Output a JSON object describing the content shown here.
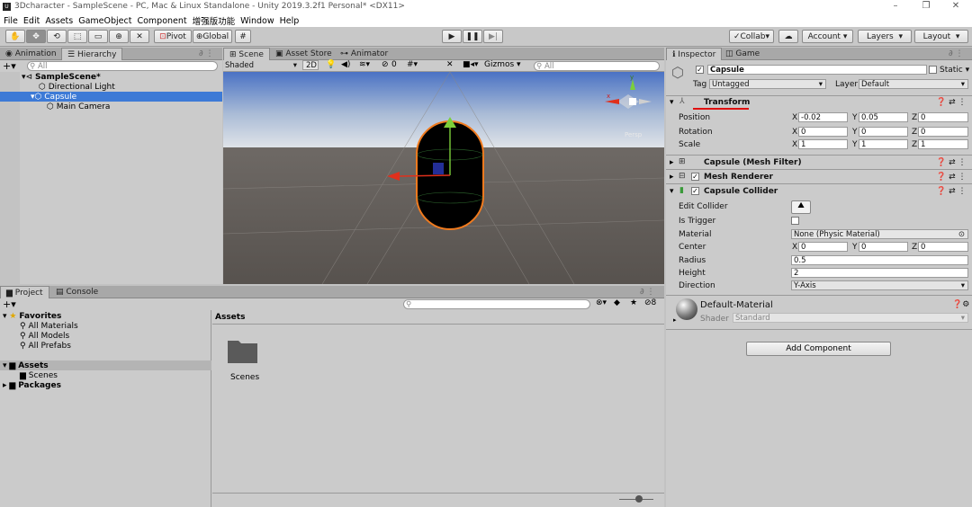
{
  "window": {
    "title": "3Dcharacter - SampleScene - PC, Mac & Linux Standalone - Unity 2019.3.2f1 Personal* <DX11>",
    "app_icon": "U"
  },
  "menu": [
    "File",
    "Edit",
    "Assets",
    "GameObject",
    "Component",
    "增强版功能",
    "Window",
    "Help"
  ],
  "toolbar": {
    "pivot": "Pivot",
    "global": "Global",
    "collab": "Collab",
    "account": "Account",
    "layers": "Layers",
    "layout": "Layout"
  },
  "left_top": {
    "tabs": [
      "Animation",
      "Hierarchy"
    ],
    "search_placeholder": "All",
    "scene": "SampleScene*",
    "items": [
      "Directional Light",
      "Capsule",
      "Main Camera"
    ]
  },
  "scene_view": {
    "tabs": [
      "Scene",
      "Asset Store",
      "Animator"
    ],
    "shading": "Shaded",
    "mode2d": "2D",
    "gizmos": "Gizmos",
    "search_placeholder": "All",
    "fx_count": "0",
    "persp": "Persp"
  },
  "project": {
    "tabs": [
      "Project",
      "Console"
    ],
    "favorites": "Favorites",
    "fav_items": [
      "All Materials",
      "All Models",
      "All Prefabs"
    ],
    "assets": "Assets",
    "asset_children": [
      "Scenes"
    ],
    "packages": "Packages",
    "breadcrumb": "Assets",
    "folder": "Scenes",
    "hidden_count": "8"
  },
  "inspector": {
    "tabs": [
      "Inspector",
      "Game"
    ],
    "object_name": "Capsule",
    "static_label": "Static",
    "tag_label": "Tag",
    "tag": "Untagged",
    "layer_label": "Layer",
    "layer": "Default",
    "transform": {
      "title": "Transform",
      "position_label": "Position",
      "rotation_label": "Rotation",
      "scale_label": "Scale",
      "position": [
        "-0.02",
        "0.05",
        "0"
      ],
      "rotation": [
        "0",
        "0",
        "0"
      ],
      "scale": [
        "1",
        "1",
        "1"
      ]
    },
    "axes": [
      "X",
      "Y",
      "Z"
    ],
    "mesh_filter": "Capsule (Mesh Filter)",
    "mesh_renderer": "Mesh Renderer",
    "collider": {
      "title": "Capsule Collider",
      "edit_label": "Edit Collider",
      "trigger_label": "Is Trigger",
      "material_label": "Material",
      "material": "None (Physic Material)",
      "center_label": "Center",
      "center": [
        "0",
        "0",
        "0"
      ],
      "radius_label": "Radius",
      "radius": "0.5",
      "height_label": "Height",
      "height": "2",
      "direction_label": "Direction",
      "direction": "Y-Axis"
    },
    "material": {
      "name": "Default-Material",
      "shader_label": "Shader",
      "shader": "Standard"
    },
    "add_component": "Add Component"
  },
  "colors": {
    "selection": "#3d7ad6",
    "accent_underline": "#e01010",
    "capsule_outline": "#f07a1e"
  }
}
